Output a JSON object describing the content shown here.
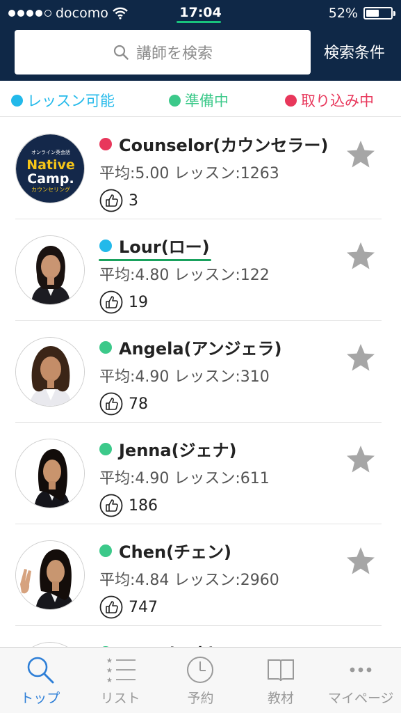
{
  "status_bar": {
    "carrier": "docomo",
    "time": "17:04",
    "battery_percent": "52%",
    "battery_level": 0.52
  },
  "header": {
    "search_placeholder": "講師を検索",
    "search_conditions_label": "検索条件"
  },
  "legend": [
    {
      "label": "レッスン可能",
      "color": "#23b9ea"
    },
    {
      "label": "準備中",
      "color": "#3cc98a"
    },
    {
      "label": "取り込み中",
      "color": "#e8375b"
    }
  ],
  "teachers": [
    {
      "name": "Counselor(カウンセラー)",
      "status_color": "#e8375b",
      "stats": "平均:5.00 レッスン:1263",
      "likes": "3",
      "logo_small": "オンライン英会話",
      "logo_main1": "Native",
      "logo_main2": "Camp.",
      "logo_sub": "カウンセリング"
    },
    {
      "name": "Lour(ロー)",
      "status_color": "#23b9ea",
      "stats": "平均:4.80 レッスン:122",
      "likes": "19"
    },
    {
      "name": "Angela(アンジェラ)",
      "status_color": "#3cc98a",
      "stats": "平均:4.90 レッスン:310",
      "likes": "78"
    },
    {
      "name": "Jenna(ジェナ)",
      "status_color": "#3cc98a",
      "stats": "平均:4.90 レッスン:611",
      "likes": "186"
    },
    {
      "name": "Chen(チェン)",
      "status_color": "#3cc98a",
      "stats": "平均:4.84 レッスン:2960",
      "likes": "747"
    },
    {
      "name": "Hana(ハナ)",
      "status_color": "#3cc98a",
      "stats": "",
      "likes": ""
    }
  ],
  "tabs": [
    {
      "label": "トップ",
      "icon": "search-icon",
      "active": true
    },
    {
      "label": "リスト",
      "icon": "list-icon",
      "active": false
    },
    {
      "label": "予約",
      "icon": "clock-icon",
      "active": false
    },
    {
      "label": "教材",
      "icon": "book-icon",
      "active": false
    },
    {
      "label": "マイページ",
      "icon": "more-icon",
      "active": false
    }
  ],
  "colors": {
    "header_bg": "#0f2847",
    "active_tab": "#2e7fd7",
    "star": "#a6a6a6"
  }
}
